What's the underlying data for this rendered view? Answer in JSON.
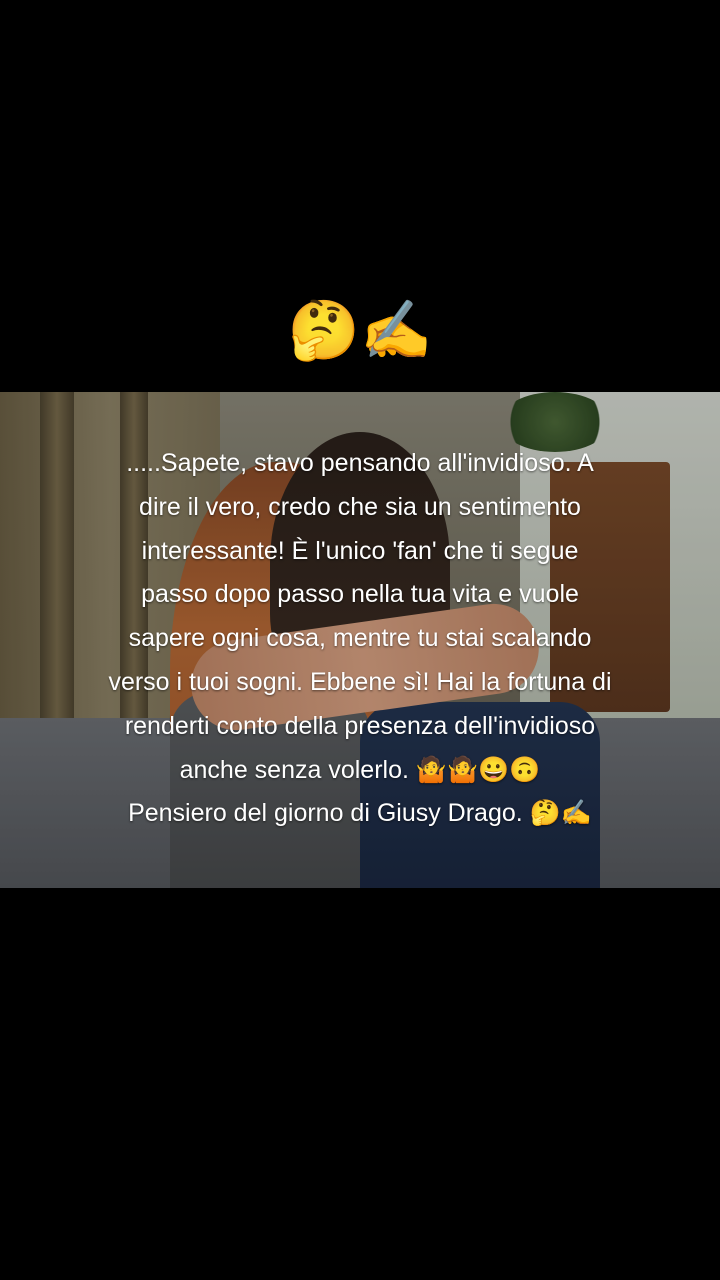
{
  "header": {
    "emojis": "🤔✍️"
  },
  "photo": {
    "icon": "photo-two-women-hugging"
  },
  "caption": {
    "lines": [
      ".....Sapete, stavo pensando all'invidioso. A",
      "dire il vero, credo che sia un sentimento",
      "interessante! È l'unico 'fan' che ti segue",
      "passo dopo passo nella tua vita e vuole",
      "sapere ogni cosa, mentre tu stai scalando",
      "verso i tuoi sogni. Ebbene sì! Hai la fortuna di",
      "renderti conto della presenza dell'invidioso",
      "anche senza volerlo. 🤷🤷😀🙃",
      "Pensiero del giorno di Giusy Drago. 🤔✍️"
    ]
  }
}
